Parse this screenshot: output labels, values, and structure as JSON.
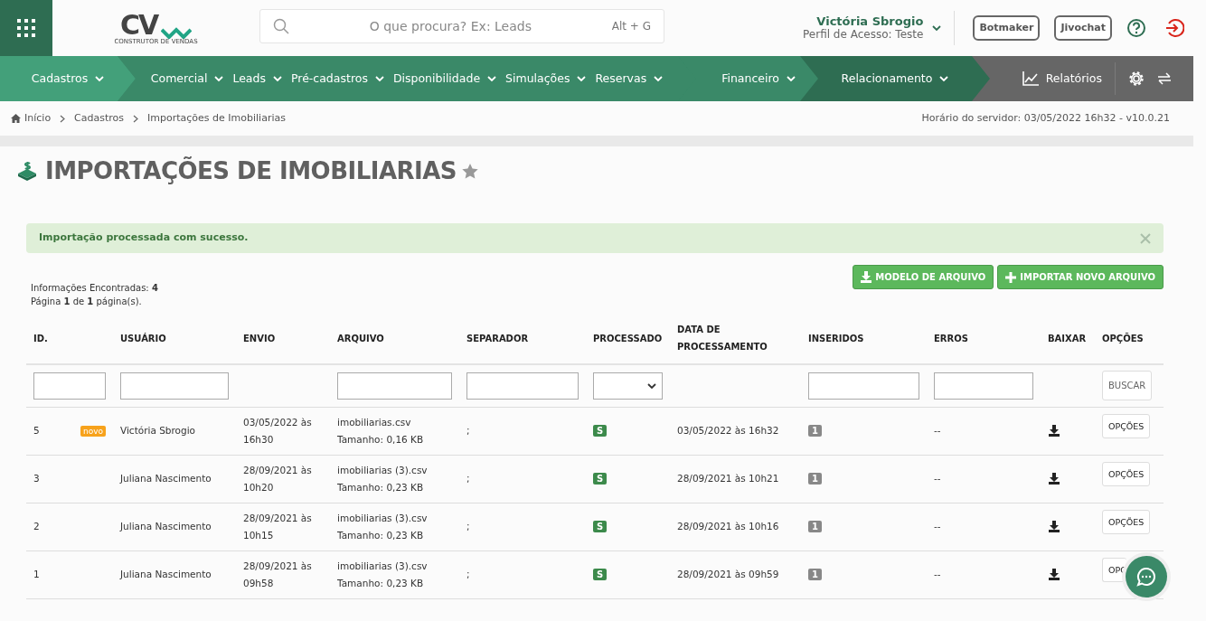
{
  "logo": {
    "text": "CV",
    "tagline": "CONSTRUTOR DE VENDAS"
  },
  "search": {
    "placeholder": "O que procura? Ex: Leads",
    "shortcut": "Alt + G"
  },
  "user": {
    "name": "Victória Sbrogio",
    "profile": "Perfil de Acesso: Teste"
  },
  "header_buttons": [
    "Botmaker",
    "Jivochat"
  ],
  "nav_groups": [
    {
      "color": "#43a07a",
      "items": [
        "Cadastros"
      ]
    },
    {
      "color": "#3a8968",
      "items": [
        "Comercial",
        "Leads",
        "Pré-cadastros",
        "Disponibilidade",
        "Simulações",
        "Reservas"
      ]
    },
    {
      "color": "#3a8968",
      "items": [
        "Financeiro"
      ]
    },
    {
      "color": "#2e6d52",
      "items": [
        "Relacionamento"
      ]
    }
  ],
  "reports": "Relatórios",
  "breadcrumb": [
    "Início",
    "Cadastros",
    "Importações de Imobiliarias"
  ],
  "server_time": "Horário do servidor: 03/05/2022 16h32 - v10.0.21",
  "page_title": "IMPORTAÇÕES DE IMOBILIARIAS",
  "alert": "Importação processada com sucesso.",
  "summary": [
    "Informações Encontradas: **4**",
    "Página **1** de **1** página(s)."
  ],
  "actions": [
    {
      "kind": "download",
      "label": "MODELO DE ARQUIVO"
    },
    {
      "kind": "add",
      "label": "IMPORTAR NOVO ARQUIVO"
    }
  ],
  "table": {
    "columns": [
      {
        "label": "ID.",
        "filter": {
          "kind": "text"
        }
      },
      {
        "label": "USUÁRIO",
        "filter": {
          "kind": "text"
        }
      },
      {
        "label": "ENVIO"
      },
      {
        "label": "ARQUIVO",
        "filter": {
          "kind": "text"
        }
      },
      {
        "label": "SEPARADOR",
        "filter": {
          "kind": "text"
        }
      },
      {
        "label": "PROCESSADO",
        "filter": {
          "kind": "select"
        }
      },
      {
        "label": "DATA DE PROCESSAMENTO"
      },
      {
        "label": "INSERIDOS",
        "filter": {
          "kind": "text"
        }
      },
      {
        "label": "ERROS",
        "filter": {
          "kind": "text"
        }
      },
      {
        "label": "BAIXAR"
      },
      {
        "label": "OPÇÕES",
        "filter": {
          "kind": "button",
          "button": "BUSCAR"
        }
      }
    ],
    "rows": [
      {
        "id": "5",
        "badge": "novo",
        "user": "Victória Sbrogio",
        "sent": "03/05/2022 às 16h30",
        "file": "imobiliarias.csv",
        "size": "Tamanho: 0,16 KB",
        "separator": ";",
        "processed": "S",
        "processed_at": "03/05/2022 às 16h32",
        "inserted": "1",
        "errors": "--",
        "options": "OPÇÕES"
      },
      {
        "id": "3",
        "user": "Juliana Nascimento",
        "sent": "28/09/2021 às 10h20",
        "file": "imobiliarias (3).csv",
        "size": "Tamanho: 0,23 KB",
        "separator": ";",
        "processed": "S",
        "processed_at": "28/09/2021 às 10h21",
        "inserted": "1",
        "errors": "--",
        "options": "OPÇÕES"
      },
      {
        "id": "2",
        "user": "Juliana Nascimento",
        "sent": "28/09/2021 às 10h15",
        "file": "imobiliarias (3).csv",
        "size": "Tamanho: 0,23 KB",
        "separator": ";",
        "processed": "S",
        "processed_at": "28/09/2021 às 10h16",
        "inserted": "1",
        "errors": "--",
        "options": "OPÇÕES"
      },
      {
        "id": "1",
        "user": "Juliana Nascimento",
        "sent": "28/09/2021 às 09h58",
        "file": "imobiliarias (3).csv",
        "size": "Tamanho: 0,23 KB",
        "separator": ";",
        "processed": "S",
        "processed_at": "28/09/2021 às 09h59",
        "inserted": "1",
        "errors": "--",
        "options": "OPÇ"
      }
    ]
  }
}
